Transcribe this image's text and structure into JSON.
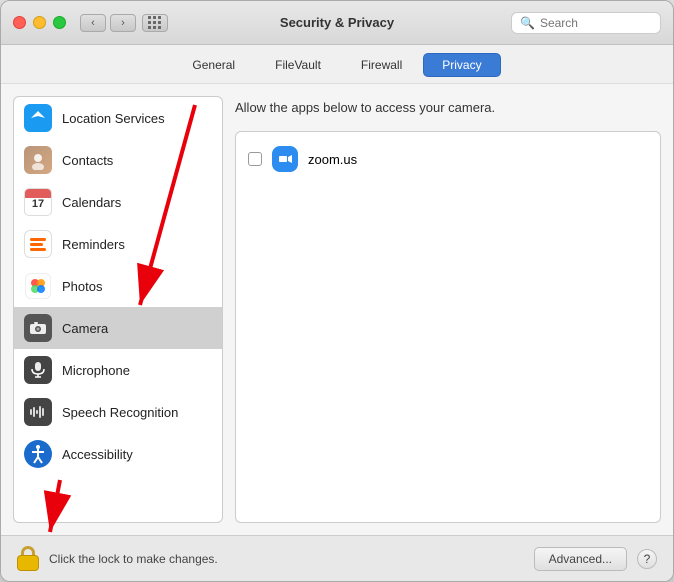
{
  "window": {
    "title": "Security & Privacy"
  },
  "search": {
    "placeholder": "Search"
  },
  "tabs": [
    {
      "id": "general",
      "label": "General",
      "active": false
    },
    {
      "id": "filevault",
      "label": "FileVault",
      "active": false
    },
    {
      "id": "firewall",
      "label": "Firewall",
      "active": false
    },
    {
      "id": "privacy",
      "label": "Privacy",
      "active": true
    }
  ],
  "sidebar": {
    "items": [
      {
        "id": "location-services",
        "label": "Location Services",
        "icon": "location"
      },
      {
        "id": "contacts",
        "label": "Contacts",
        "icon": "contacts"
      },
      {
        "id": "calendars",
        "label": "Calendars",
        "icon": "calendars"
      },
      {
        "id": "reminders",
        "label": "Reminders",
        "icon": "reminders"
      },
      {
        "id": "photos",
        "label": "Photos",
        "icon": "photos"
      },
      {
        "id": "camera",
        "label": "Camera",
        "icon": "camera",
        "active": true
      },
      {
        "id": "microphone",
        "label": "Microphone",
        "icon": "microphone"
      },
      {
        "id": "speech-recognition",
        "label": "Speech Recognition",
        "icon": "speechrec"
      },
      {
        "id": "accessibility",
        "label": "Accessibility",
        "icon": "accessibility"
      }
    ]
  },
  "panel": {
    "description": "Allow the apps below to access your camera.",
    "apps": [
      {
        "id": "zoom",
        "name": "zoom.us",
        "checked": false
      }
    ]
  },
  "bottom": {
    "lock_text": "Click the lock to make changes.",
    "advanced_label": "Advanced...",
    "help_label": "?"
  }
}
